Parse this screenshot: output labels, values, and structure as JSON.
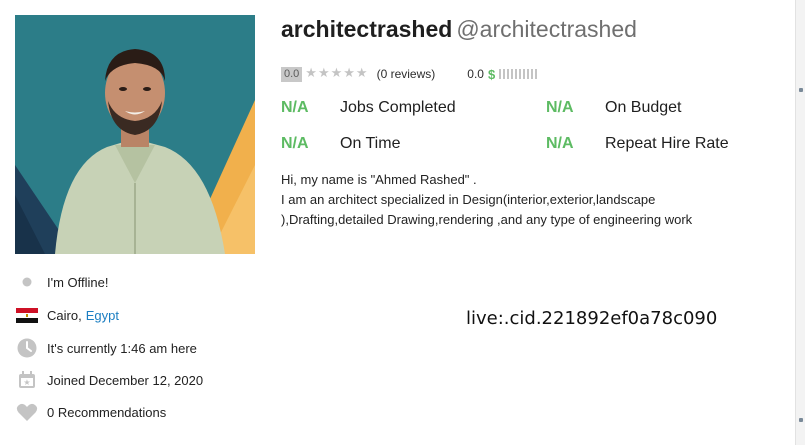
{
  "profile": {
    "username": "architectrashed",
    "handle": "@architectrashed",
    "avatar_alt": "profile photo"
  },
  "rating": {
    "score": "0.0",
    "stars_filled": 0,
    "stars_total": 5,
    "reviews": "(0 reviews)",
    "earnings_score": "0.0",
    "earnings_symbol": "$",
    "earnings_level": 0
  },
  "stats": [
    {
      "value": "N/A",
      "label": "Jobs Completed"
    },
    {
      "value": "N/A",
      "label": "On Budget"
    },
    {
      "value": "N/A",
      "label": "On Time"
    },
    {
      "value": "N/A",
      "label": "Repeat Hire Rate"
    }
  ],
  "bio": {
    "line1": "Hi, my name is \"Ahmed Rashed\" .",
    "line2": "I am an architect specialized in Design(interior,exterior,landscape",
    "line3": "),Drafting,detailed Drawing,rendering ,and any type of engineering work"
  },
  "info": {
    "status": "I'm Offline!",
    "city": "Cairo,",
    "country": "Egypt",
    "local_time": "It's currently 1:46 am here",
    "joined": "Joined December 12, 2020",
    "recommendations": "0 Recommendations"
  },
  "overlay": {
    "live_id": "live:.cid.221892ef0a78c090"
  },
  "colors": {
    "accent_green": "#5dbb63",
    "link_blue": "#1b7ec2",
    "star_gray": "#c4c4c4"
  },
  "icons": [
    "status-dot-icon",
    "egypt-flag-icon",
    "clock-icon",
    "calendar-icon",
    "heart-icon",
    "star-icon"
  ]
}
